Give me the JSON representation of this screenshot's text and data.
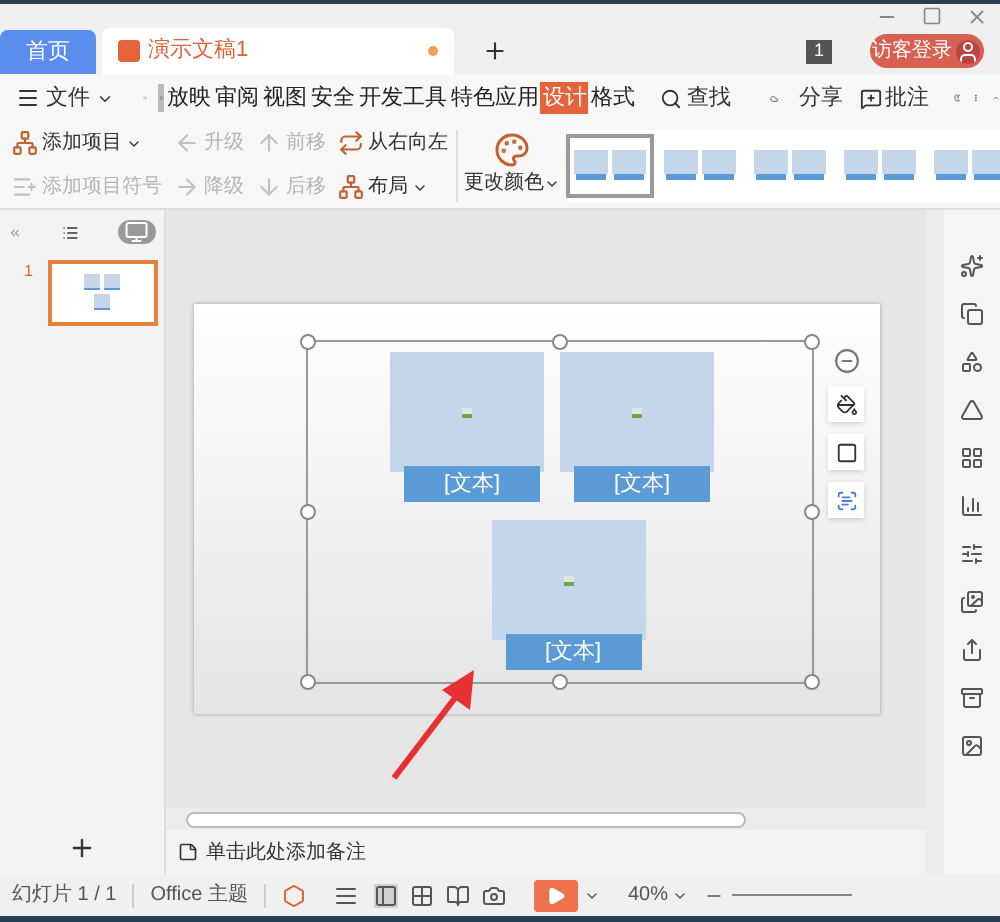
{
  "tabs": [
    {
      "label": "首页",
      "kind": "home",
      "selected": false
    },
    {
      "label": "演示文稿1",
      "kind": "doc",
      "selected": true,
      "unsaved": true
    }
  ],
  "top_bar": {
    "badge": "1",
    "login": "访客登录"
  },
  "menu": {
    "file": "文件",
    "ribbon_tabs": [
      {
        "label": "放映",
        "selected": false
      },
      {
        "label": "审阅",
        "selected": false
      },
      {
        "label": "视图",
        "selected": false
      },
      {
        "label": "安全",
        "selected": false
      },
      {
        "label": "开发工具",
        "selected": false
      },
      {
        "label": "特色应用",
        "selected": false
      },
      {
        "label": "设计",
        "selected": true
      },
      {
        "label": "格式",
        "selected": false
      }
    ],
    "search": "查找",
    "share": "分享",
    "comment": "批注"
  },
  "ribbon": {
    "commands": [
      {
        "label": "添加项目",
        "kind": "add-item",
        "disabled": false,
        "dropdown": true
      },
      {
        "label": "添加项目符号",
        "kind": "add-bullet",
        "disabled": true,
        "dropdown": false
      },
      {
        "label": "升级",
        "kind": "promote",
        "disabled": true,
        "dropdown": false
      },
      {
        "label": "降级",
        "kind": "demote",
        "disabled": true,
        "dropdown": false
      },
      {
        "label": "前移",
        "kind": "move-up",
        "disabled": true,
        "dropdown": false
      },
      {
        "label": "后移",
        "kind": "move-down",
        "disabled": true,
        "dropdown": false
      },
      {
        "label": "从右向左",
        "kind": "rtl",
        "disabled": false,
        "dropdown": false
      },
      {
        "label": "布局",
        "kind": "layout",
        "disabled": false,
        "dropdown": true
      }
    ],
    "change_color": "更改颜色",
    "styles": [
      {
        "selected": true
      },
      {
        "selected": false
      },
      {
        "selected": false
      },
      {
        "selected": false
      },
      {
        "selected": false
      }
    ]
  },
  "slides_panel": {
    "slides": [
      {
        "number": "1",
        "selected": true
      }
    ]
  },
  "slide": {
    "items": [
      {
        "text": "[文本]"
      },
      {
        "text": "[文本]"
      },
      {
        "text": "[文本]"
      }
    ]
  },
  "notes": {
    "placeholder": "单击此处添加备注"
  },
  "status_bar": {
    "slide_count": "幻灯片 1 / 1",
    "theme": "Office 主题",
    "zoom": "40%"
  }
}
